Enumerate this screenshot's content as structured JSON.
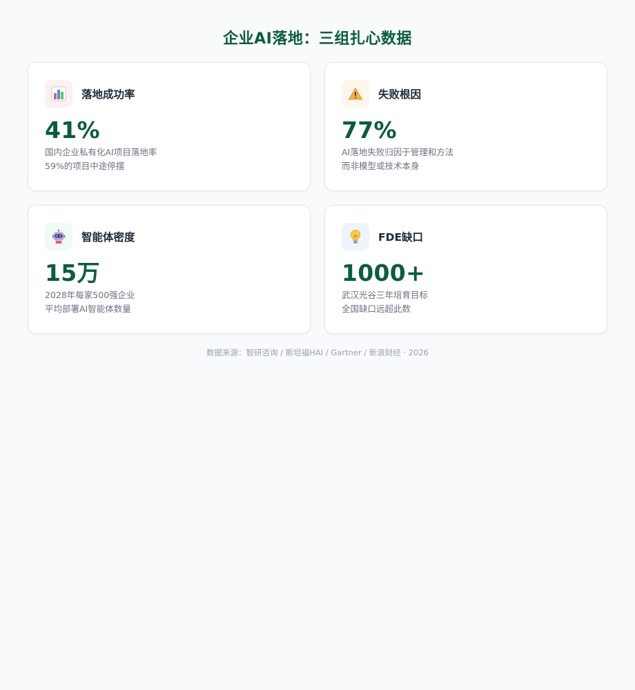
{
  "title": "企业AI落地：三组扎心数据",
  "cards": [
    {
      "icon": "bar-chart-icon",
      "icon_bg": "#fdf0f0",
      "title": "落地成功率",
      "metric": "41%",
      "desc_line1": "国内企业私有化AI项目落地率",
      "desc_line2": "59%的项目中途停摆"
    },
    {
      "icon": "warning-icon",
      "icon_bg": "#fdf6ec",
      "title": "失败根因",
      "metric": "77%",
      "desc_line1": "AI落地失败归因于管理和方法",
      "desc_line2": "而非模型或技术本身"
    },
    {
      "icon": "robot-icon",
      "icon_bg": "#eefaf3",
      "title": "智能体密度",
      "metric": "15万",
      "desc_line1": "2028年每家500强企业",
      "desc_line2": "平均部署AI智能体数量"
    },
    {
      "icon": "lightbulb-icon",
      "icon_bg": "#eef4fb",
      "title": "FDE缺口",
      "metric": "1000+",
      "desc_line1": "武汉光谷三年培育目标",
      "desc_line2": "全国缺口远超此数"
    }
  ],
  "footer": "数据来源：智研咨询 / 斯坦福HAI / Gartner / 新浪财经 · 2026",
  "colors": {
    "accent": "#0b5d3b",
    "background": "#f8fafc",
    "card": "#ffffff",
    "muted_text": "#6b7280"
  }
}
